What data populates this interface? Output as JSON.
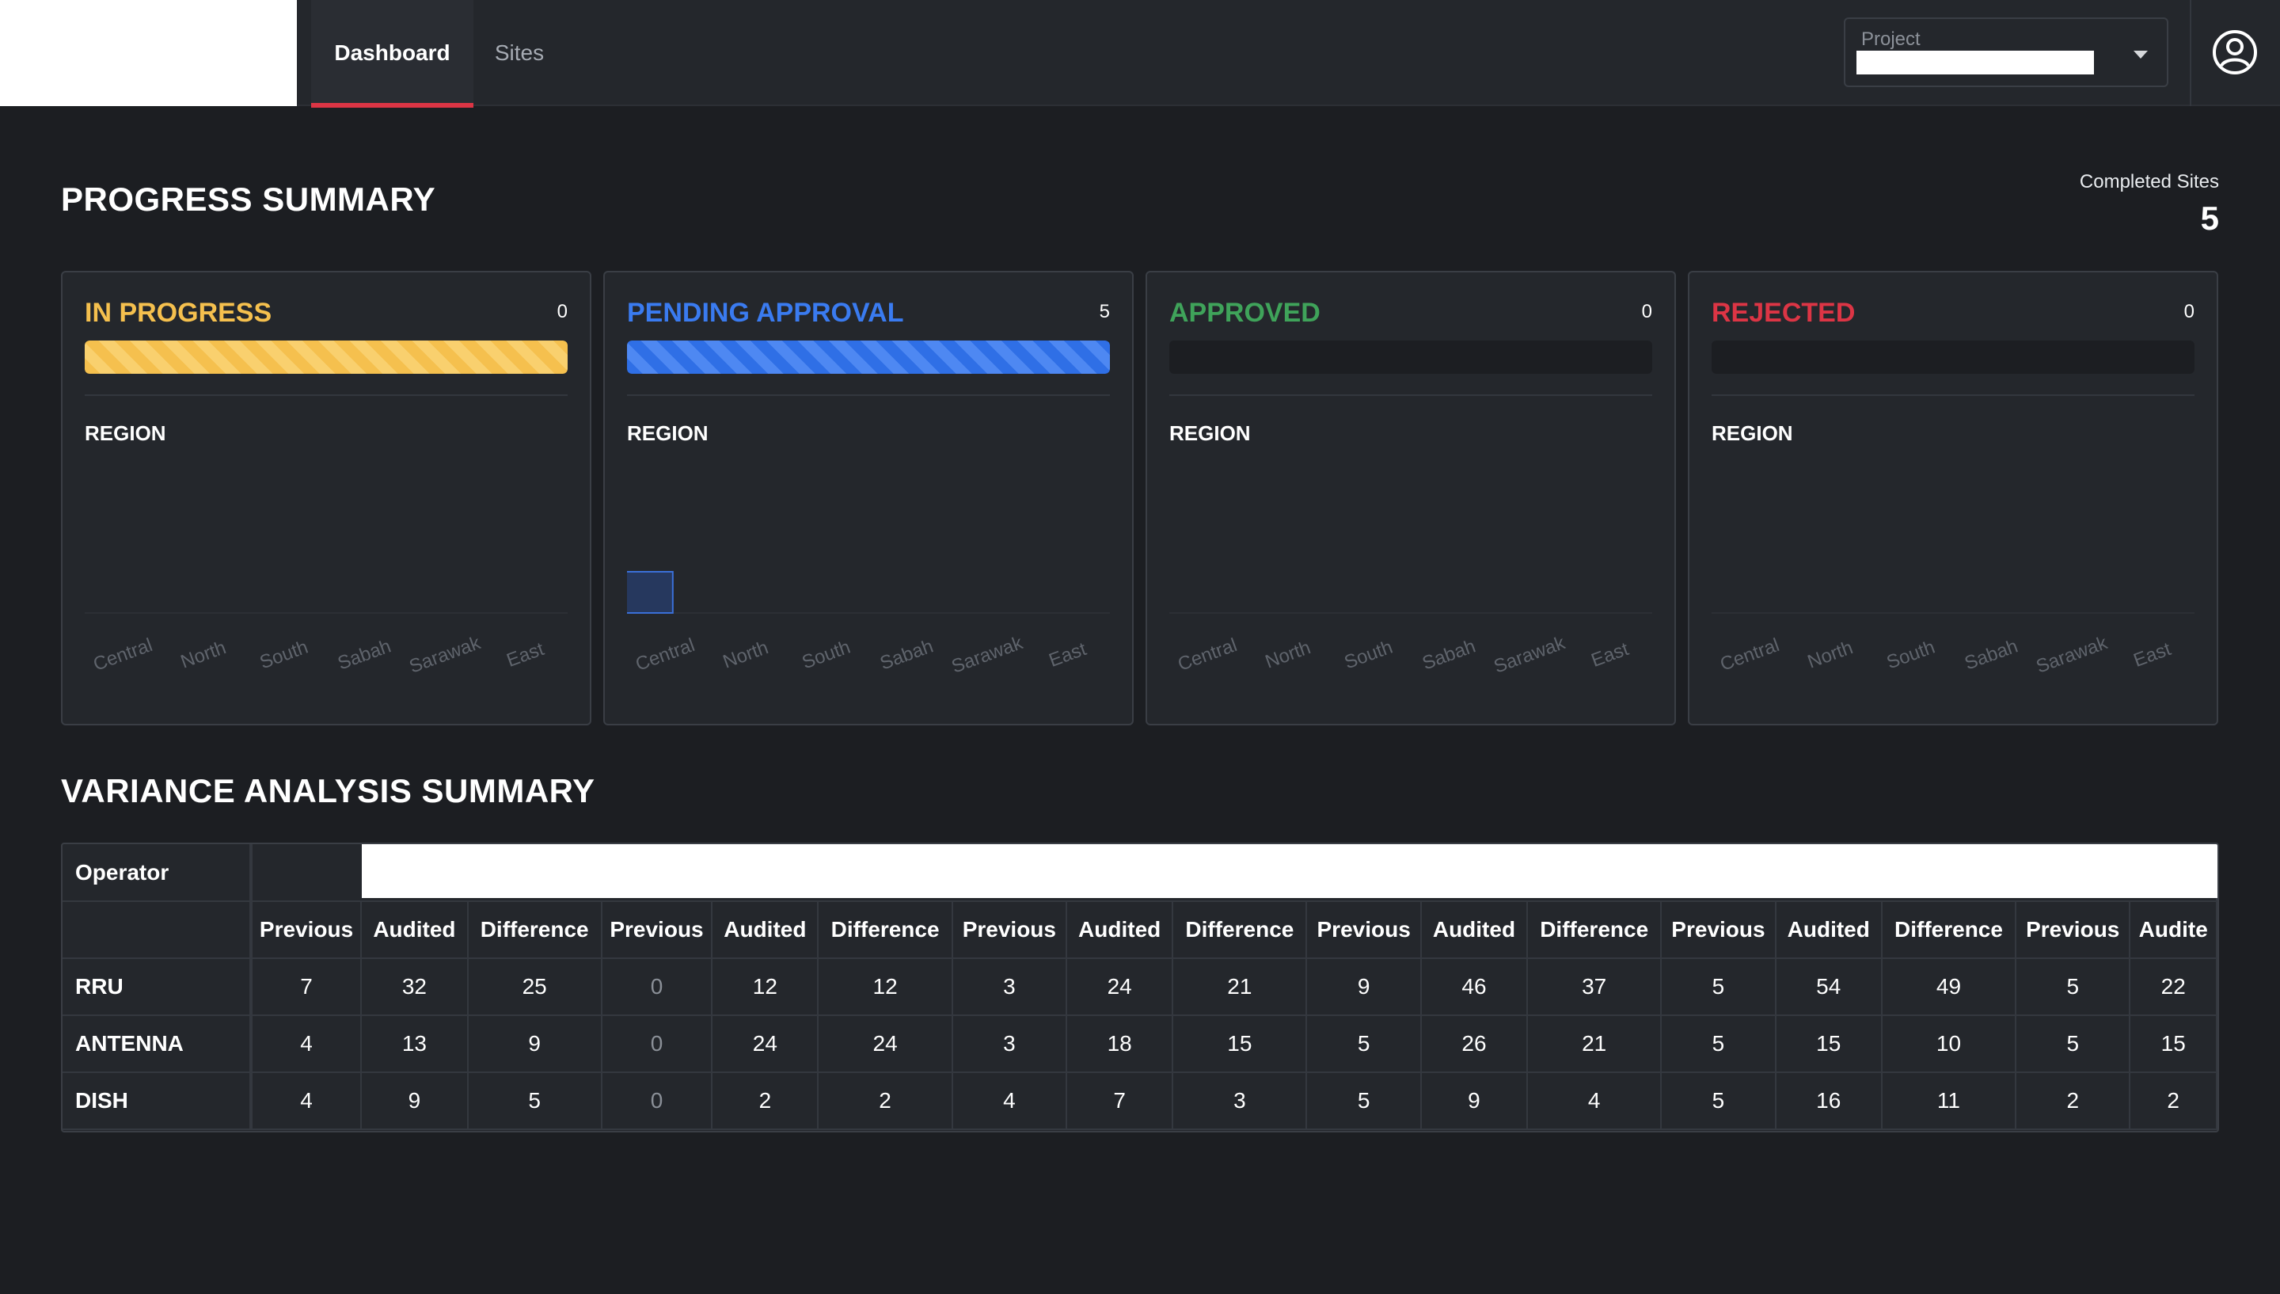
{
  "nav": {
    "tabs": [
      {
        "label": "Dashboard",
        "active": true
      },
      {
        "label": "Sites",
        "active": false
      }
    ],
    "project": {
      "label": "Project",
      "value": ""
    }
  },
  "progress": {
    "title": "PROGRESS SUMMARY",
    "completed_label": "Completed Sites",
    "completed_value": "5",
    "cards": [
      {
        "title": "IN PROGRESS",
        "count": "0",
        "color": "#f5c04e",
        "bar_fill_fraction": 1.0,
        "bar_style": "yellow"
      },
      {
        "title": "PENDING APPROVAL",
        "count": "5",
        "color": "#3a7bf0",
        "bar_fill_fraction": 1.0,
        "bar_style": "blue"
      },
      {
        "title": "APPROVED",
        "count": "0",
        "color": "#3fa35a",
        "bar_fill_fraction": 0.0,
        "bar_style": "none"
      },
      {
        "title": "REJECTED",
        "count": "0",
        "color": "#dc3545",
        "bar_fill_fraction": 0.0,
        "bar_style": "none"
      }
    ],
    "region_label": "REGION"
  },
  "chart_data": [
    {
      "type": "bar",
      "categories": [
        "Central",
        "North",
        "South",
        "Sabah",
        "Sarawak",
        "East"
      ],
      "values": [
        0,
        0,
        0,
        0,
        0,
        0
      ]
    },
    {
      "type": "bar",
      "categories": [
        "Central",
        "North",
        "South",
        "Sabah",
        "Sarawak",
        "East"
      ],
      "values": [
        1,
        0,
        0,
        0,
        0,
        0
      ]
    },
    {
      "type": "bar",
      "categories": [
        "Central",
        "North",
        "South",
        "Sabah",
        "Sarawak",
        "East"
      ],
      "values": [
        0,
        0,
        0,
        0,
        0,
        0
      ]
    },
    {
      "type": "bar",
      "categories": [
        "Central",
        "North",
        "South",
        "Sabah",
        "Sarawak",
        "East"
      ],
      "values": [
        0,
        0,
        0,
        0,
        0,
        0
      ]
    }
  ],
  "variance": {
    "title": "VARIANCE ANALYSIS SUMMARY",
    "operator_label": "Operator",
    "sub_headers": [
      "Previous",
      "Audited",
      "Difference",
      "Previous",
      "Audited",
      "Difference",
      "Previous",
      "Audited",
      "Difference",
      "Previous",
      "Audited",
      "Difference",
      "Previous",
      "Audited",
      "Difference",
      "Previous",
      "Audite"
    ],
    "rows": [
      {
        "name": "RRU",
        "values": [
          "7",
          "32",
          "25",
          "0",
          "12",
          "12",
          "3",
          "24",
          "21",
          "9",
          "46",
          "37",
          "5",
          "54",
          "49",
          "5",
          "22"
        ]
      },
      {
        "name": "ANTENNA",
        "values": [
          "4",
          "13",
          "9",
          "0",
          "24",
          "24",
          "3",
          "18",
          "15",
          "5",
          "26",
          "21",
          "5",
          "15",
          "10",
          "5",
          "15"
        ]
      },
      {
        "name": "DISH",
        "values": [
          "4",
          "9",
          "5",
          "0",
          "2",
          "2",
          "4",
          "7",
          "3",
          "5",
          "9",
          "4",
          "5",
          "16",
          "11",
          "2",
          "2"
        ]
      }
    ],
    "muted_column_index": 3
  }
}
